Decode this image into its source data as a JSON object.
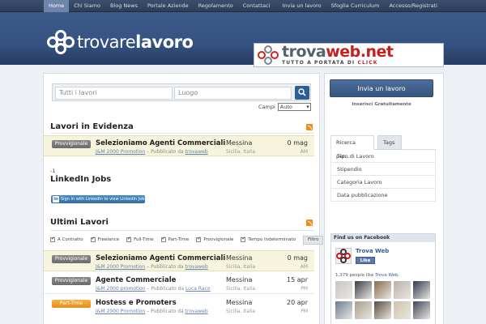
{
  "topnav": {
    "left": [
      "Home",
      "Chi Siamo",
      "Blog News",
      "Portale Aziende",
      "Regolamento",
      "Contattaci"
    ],
    "right": [
      "Invia un lavoro",
      "Sfoglia Curriculum",
      "Accesso/Registrati"
    ]
  },
  "header": {
    "logo_left": "trovare",
    "logo_right": "lavoro",
    "banner_title_a": "trova",
    "banner_title_b": "web.net",
    "banner_tag_a": "TUTTO A PORTATA DI ",
    "banner_tag_b": "CLICK"
  },
  "search": {
    "what_placeholder": "Tutti i lavori",
    "where_placeholder": "Luogo",
    "campi_label": "Campi",
    "campi_value": "Auto"
  },
  "featured": {
    "title": "Lavori in Evidenza",
    "jobs": [
      {
        "type": "Provvigionale",
        "title": "Selezioniamo Agenti Commerciali",
        "company": "J&M 2000 Promotion",
        "by_text": " – Pubblicato da ",
        "author": "trovaweb",
        "city": "Messina",
        "region": "Sicilia, Italia",
        "date": "0 mag",
        "time": "AM"
      }
    ]
  },
  "linkedin": {
    "counter": "-1",
    "title": "LinkedIn Jobs",
    "button": "Sign In with LinkedIn to view LinkedIn Jobs"
  },
  "latest": {
    "title": "Ultimi Lavori",
    "filters": [
      "A Contratto",
      "Freelance",
      "Full-Time",
      "Part-Time",
      "Provvigionale",
      "Tempo Indeterminato"
    ],
    "filter_button": "Filtro",
    "jobs": [
      {
        "type": "Provvigionale",
        "title": "Selezioniamo Agenti Commerciali",
        "company": "J&M 2000 Promotion",
        "by_text": " – Pubblicato da ",
        "author": "trovaweb",
        "city": "Messina",
        "region": "Sicilia, Italia",
        "date": "0 mag",
        "time": "AM"
      },
      {
        "type": "Provvigionale",
        "title": "Agente Commerciale",
        "company": "J&M 2000 promotion",
        "by_text": " – Pubblicato da ",
        "author": "Luca Raco",
        "city": "Messina",
        "region": "Sicilia, Italia",
        "date": "15 apr",
        "time": "PM"
      },
      {
        "type": "Part-Time",
        "title": "Hostess e Promoters",
        "company": "J&M 2000 Promotion",
        "by_text": " – Pubblicato da ",
        "author": "trovaweb",
        "city": "Messina",
        "region": "Sicilia, Italia",
        "date": "20 apr",
        "time": "PM"
      }
    ]
  },
  "sidebar": {
    "cta": "Invia un lavoro",
    "cta_sub": "Inserisci Gratuitamente",
    "tab1": "Ricerca per...",
    "tab2": "Tags",
    "items": [
      "Tipo di Lavoro",
      "Stipendio",
      "Categoria Lavoro",
      "Data pubblicazione"
    ],
    "fb_title": "Find us on Facebook",
    "fb_page": "Trova Web",
    "fb_like": "Like",
    "fb_count_a": "1,379 people like ",
    "fb_count_b": "Trova Web.",
    "faces": [
      "#c9c6c2",
      "#3d3f48",
      "#8a6b4f",
      "#b8b1a8",
      "#2f3b4d",
      "#6d7d92",
      "#a89c8d",
      "#5a4c41",
      "#cfc3a8",
      "#404856"
    ]
  },
  "colors": {
    "accent": "#2f5e92",
    "badge_prov": "#7a7a7a",
    "badge_pt": "#f0a030",
    "highlight_row": "#f6f4dc"
  }
}
